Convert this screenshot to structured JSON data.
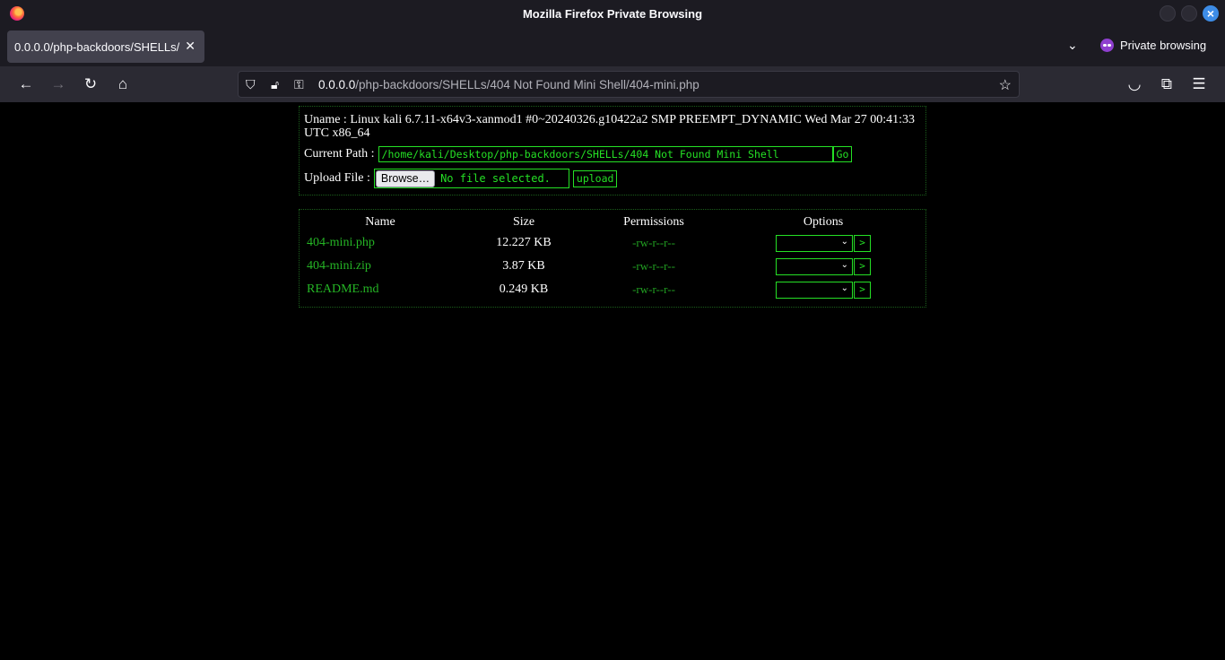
{
  "window": {
    "title": "Mozilla Firefox Private Browsing"
  },
  "tabs": [
    {
      "label": "0.0.0.0/php-backdoors/SHELLs/"
    }
  ],
  "toolbar": {
    "private_label": "Private browsing"
  },
  "url": {
    "host": "0.0.0.0",
    "path": "/php-backdoors/SHELLs/404 Not Found Mini Shell/404-mini.php"
  },
  "shell": {
    "uname_label": "Uname :",
    "uname_value": "Linux kali 6.7.11-x64v3-xanmod1 #0~20240326.g10422a2 SMP PREEMPT_DYNAMIC Wed Mar 27 00:41:33 UTC x86_64",
    "path_label": "Current Path :",
    "path_value": "/home/kali/Desktop/php-backdoors/SHELLs/404 Not Found Mini Shell",
    "go_label": "Go",
    "upload_label": "Upload File :",
    "browse_label": "Browse…",
    "no_file_label": "No file selected.",
    "upload_button": "upload"
  },
  "files": {
    "columns": [
      "Name",
      "Size",
      "Permissions",
      "Options"
    ],
    "rows": [
      {
        "name": "404-mini.php",
        "size": "12.227 KB",
        "perms": "-rw-r--r--"
      },
      {
        "name": "404-mini.zip",
        "size": "3.87 KB",
        "perms": "-rw-r--r--"
      },
      {
        "name": "README.md",
        "size": "0.249 KB",
        "perms": "-rw-r--r--"
      }
    ],
    "action_label": ">"
  }
}
